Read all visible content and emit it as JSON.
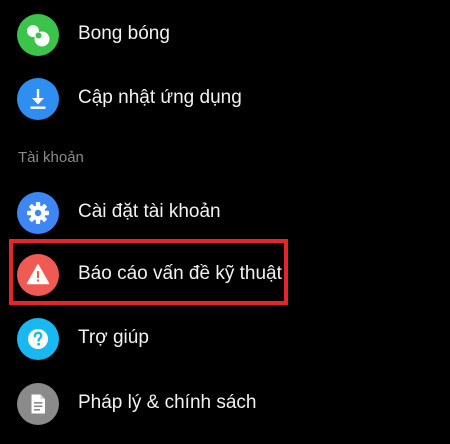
{
  "menu": {
    "items": [
      {
        "label": "Bong bóng",
        "icon": "bubbles-icon",
        "color": "#3cc34a"
      },
      {
        "label": "Cập nhật ứng dụng",
        "icon": "download-icon",
        "color": "#2f8ff0"
      }
    ],
    "section_header": "Tài khoản",
    "account_items": [
      {
        "label": "Cài đặt tài khoản",
        "icon": "gear-icon",
        "color": "#3f86f5"
      },
      {
        "label": "Báo cáo vấn đề kỹ thuật",
        "icon": "warning-icon",
        "color": "#ef5b53"
      },
      {
        "label": "Trợ giúp",
        "icon": "help-icon",
        "color": "#19b8f0"
      },
      {
        "label": "Pháp lý & chính sách",
        "icon": "document-icon",
        "color": "#8a8a8a"
      }
    ]
  },
  "highlight": {
    "color": "#e3262b"
  }
}
